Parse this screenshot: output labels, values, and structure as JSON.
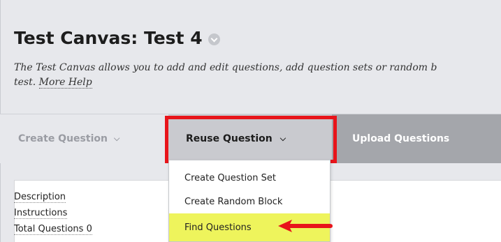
{
  "header": {
    "title": "Test Canvas: Test 4",
    "description_line1": "The Test Canvas allows you to add and edit questions, add question sets or random b",
    "description_line2": "test.",
    "more_help": "More Help"
  },
  "toolbar": {
    "create_question": "Create Question",
    "reuse_question": "Reuse Question",
    "upload_questions": "Upload Questions"
  },
  "dropdown": {
    "items": [
      "Create Question Set",
      "Create Random Block",
      "Find Questions"
    ],
    "highlight_color": "#eef45c"
  },
  "test_info": {
    "description_label": "Description",
    "instructions_label": "Instructions",
    "total_questions_label": "Total Questions",
    "total_questions_value": "0"
  },
  "annotation": {
    "callout_color": "#e8141a"
  }
}
